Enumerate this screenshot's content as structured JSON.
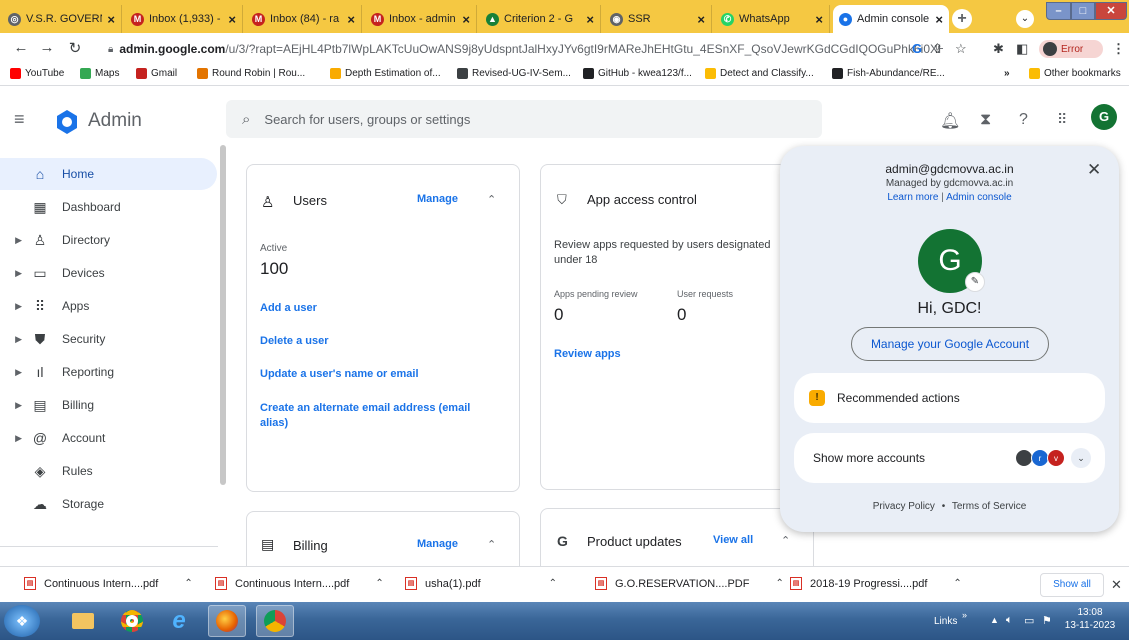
{
  "browser": {
    "tabs": [
      {
        "title": "V.S.R. GOVERNI",
        "favicon_color": "#5f6368",
        "favicon_glyph": "◎"
      },
      {
        "title": "Inbox (1,933) -",
        "favicon_color": "#c5221f",
        "favicon_glyph": "M"
      },
      {
        "title": "Inbox (84) - ra",
        "favicon_color": "#c5221f",
        "favicon_glyph": "M"
      },
      {
        "title": "Inbox - admin",
        "favicon_color": "#c5221f",
        "favicon_glyph": "M"
      },
      {
        "title": "Criterion 2 - G",
        "favicon_color": "#188038",
        "favicon_glyph": "▲"
      },
      {
        "title": "SSR",
        "favicon_color": "#5f6368",
        "favicon_glyph": "◉"
      },
      {
        "title": "WhatsApp",
        "favicon_color": "#25d366",
        "favicon_glyph": "✆"
      },
      {
        "title": "Admin console",
        "favicon_color": "#1a73e8",
        "favicon_glyph": "●"
      }
    ],
    "url": {
      "host": "admin.google.com",
      "path": "/u/3/?rapt=AEjHL4Ptb7lWpLAKTcUuOwANS9j8yUdspntJalHxyJYv6gtI9rMAReJhEHtGtu_4ESnXF_QsoVJewrKGdCGdIQOGuPhk6i0XH0J..."
    },
    "profile_label": "Error",
    "bookmarks": [
      {
        "label": "YouTube",
        "color": "#ff0000"
      },
      {
        "label": "Maps",
        "color": "#34a853"
      },
      {
        "label": "Gmail",
        "color": "#c5221f"
      },
      {
        "label": "Round Robin | Rou...",
        "color": "#e37400"
      },
      {
        "label": "Depth Estimation of...",
        "color": "#f9ab00"
      },
      {
        "label": "Revised-UG-IV-Sem...",
        "color": "#3c4043"
      },
      {
        "label": "GitHub - kwea123/f...",
        "color": "#202124"
      },
      {
        "label": "Detect and Classify...",
        "color": "#fbbc04"
      },
      {
        "label": "Fish-Abundance/RE...",
        "color": "#202124"
      }
    ],
    "other_bookmarks": "Other bookmarks",
    "more_chevron": "»"
  },
  "header": {
    "title": "Admin",
    "search_placeholder": "Search for users, groups or settings",
    "avatar_letter": "G"
  },
  "sidebar": {
    "items": [
      {
        "label": "Home",
        "icon": "⌂",
        "selected": true,
        "caret": ""
      },
      {
        "label": "Dashboard",
        "icon": "▦",
        "caret": ""
      },
      {
        "label": "Directory",
        "icon": "♙",
        "caret": "▶"
      },
      {
        "label": "Devices",
        "icon": "▭",
        "caret": "▶"
      },
      {
        "label": "Apps",
        "icon": "⠿",
        "caret": "▶"
      },
      {
        "label": "Security",
        "icon": "⛊",
        "caret": "▶"
      },
      {
        "label": "Reporting",
        "icon": "ıl",
        "caret": "▶"
      },
      {
        "label": "Billing",
        "icon": "▤",
        "caret": "▶"
      },
      {
        "label": "Account",
        "icon": "@",
        "caret": "▶"
      },
      {
        "label": "Rules",
        "icon": "◈",
        "caret": ""
      },
      {
        "label": "Storage",
        "icon": "☁",
        "caret": ""
      }
    ]
  },
  "users_card": {
    "title": "Users",
    "manage": "Manage",
    "active_label": "Active",
    "active_count": "100",
    "links": [
      "Add a user",
      "Delete a user",
      "Update a user's name or email",
      "Create an alternate email address (email alias)"
    ]
  },
  "app_access_card": {
    "title": "App access control",
    "description": "Review apps requested by users designated under 18",
    "pending_label": "Apps pending review",
    "pending_value": "0",
    "requests_label": "User requests",
    "requests_value": "0",
    "review_link": "Review apps"
  },
  "billing_card": {
    "title": "Billing",
    "manage": "Manage"
  },
  "product_updates_card": {
    "title": "Product updates",
    "view_all": "View all"
  },
  "account_popup": {
    "email": "admin@gdcmovva.ac.in",
    "managed_by": "Managed by gdcmovva.ac.in",
    "learn_more": "Learn more",
    "separator": "|",
    "admin_console": "Admin console",
    "avatar_letter": "G",
    "greeting": "Hi, GDC!",
    "manage_account": "Manage your Google Account",
    "recommended": "Recommended actions",
    "show_more": "Show more accounts",
    "other_accounts": [
      {
        "letter": "",
        "color": "#3c4043"
      },
      {
        "letter": "r",
        "color": "#1967d2"
      },
      {
        "letter": "v",
        "color": "#c5221f"
      }
    ],
    "privacy": "Privacy Policy",
    "dot": "•",
    "terms": "Terms of Service"
  },
  "downloads": {
    "items": [
      "Continuous Intern....pdf",
      "Continuous Intern....pdf",
      "usha(1).pdf",
      "G.O.RESERVATION....PDF",
      "2018-19 Progressi....pdf"
    ],
    "show_all": "Show all"
  },
  "taskbar": {
    "links_label": "Links",
    "time": "13:08",
    "date": "13-11-2023"
  }
}
